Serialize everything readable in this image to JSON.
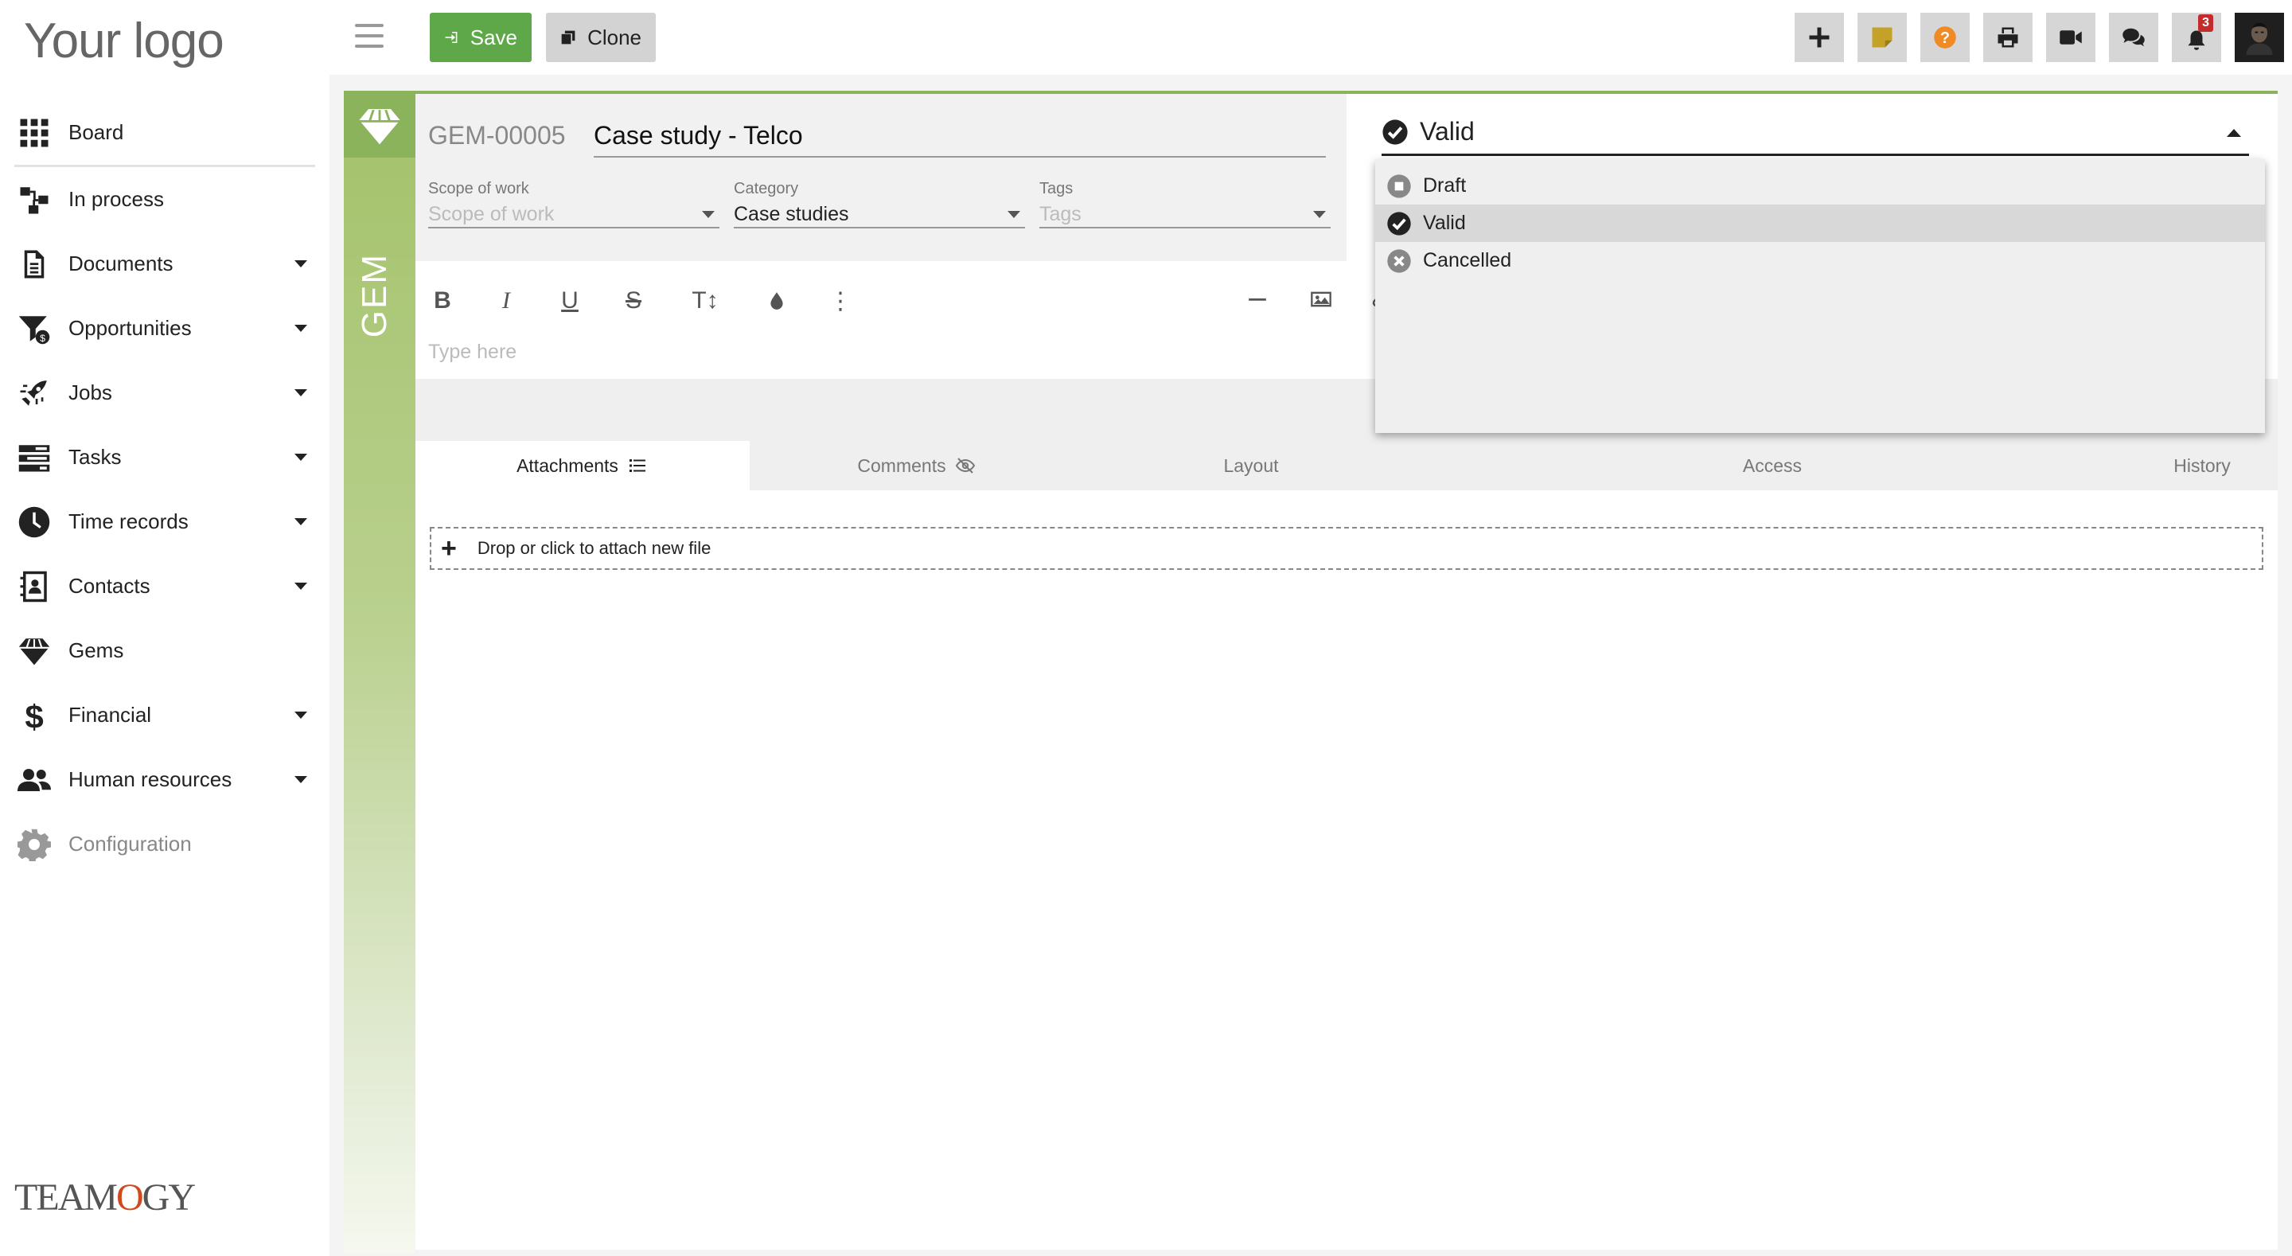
{
  "logo": {
    "text": "Your logo"
  },
  "brand": {
    "prefix": "TEAM",
    "o": "O",
    "suffix": "GY"
  },
  "sidebar": {
    "items": [
      {
        "label": "Board",
        "icon": "grid-icon",
        "has_caret": false
      },
      {
        "label": "In process",
        "icon": "process-icon",
        "has_caret": false
      },
      {
        "label": "Documents",
        "icon": "document-icon",
        "has_caret": true
      },
      {
        "label": "Opportunities",
        "icon": "funnel-dollar-icon",
        "has_caret": true
      },
      {
        "label": "Jobs",
        "icon": "rocket-icon",
        "has_caret": true
      },
      {
        "label": "Tasks",
        "icon": "tasks-icon",
        "has_caret": true
      },
      {
        "label": "Time records",
        "icon": "clock-icon",
        "has_caret": true
      },
      {
        "label": "Contacts",
        "icon": "contact-card-icon",
        "has_caret": true
      },
      {
        "label": "Gems",
        "icon": "gem-icon",
        "has_caret": false
      },
      {
        "label": "Financial",
        "icon": "dollar-icon",
        "has_caret": true
      },
      {
        "label": "Human resources",
        "icon": "users-icon",
        "has_caret": true
      },
      {
        "label": "Configuration",
        "icon": "gear-icon",
        "has_caret": false
      }
    ]
  },
  "toolbar": {
    "save_label": "Save",
    "clone_label": "Clone",
    "notification_count": "3",
    "icons": [
      "plus-icon",
      "sticky-note-icon",
      "help-icon",
      "print-icon",
      "video-icon",
      "chat-icon",
      "bell-icon",
      "user-avatar"
    ]
  },
  "record": {
    "strip_label": "GEM",
    "id": "GEM-00005",
    "title": "Case study - Telco",
    "fields": {
      "scope": {
        "label": "Scope of work",
        "value": "Scope of work"
      },
      "category": {
        "label": "Category",
        "value": "Case studies"
      },
      "tags": {
        "label": "Tags",
        "value": "Tags"
      }
    },
    "editor_placeholder": "Type here"
  },
  "tabs": [
    {
      "label": "Attachments",
      "active": true
    },
    {
      "label": "Comments",
      "active": false
    },
    {
      "label": "Layout",
      "active": false
    },
    {
      "label": "Access",
      "active": false
    },
    {
      "label": "History",
      "active": false
    }
  ],
  "dropzone_text": "Drop or click to attach new file",
  "status": {
    "current": "Valid",
    "options": [
      {
        "label": "Draft",
        "icon": "draft-icon"
      },
      {
        "label": "Valid",
        "icon": "check-circle-icon"
      },
      {
        "label": "Cancelled",
        "icon": "x-circle-icon"
      }
    ]
  },
  "colors": {
    "accent_green": "#8bb35b",
    "save_green": "#5fa84a",
    "badge_red": "#c42b2b"
  }
}
